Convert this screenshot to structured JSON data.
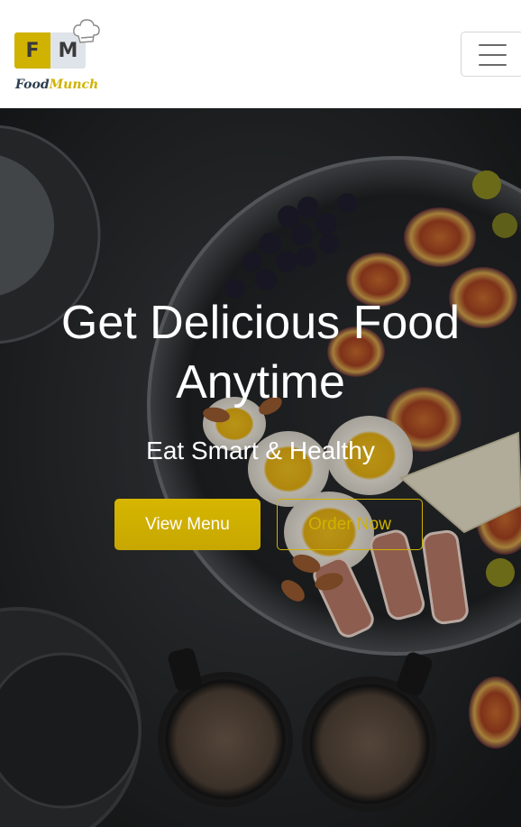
{
  "navbar": {
    "logo": {
      "letter_f": "F",
      "letter_m": "M",
      "brand_part1": "Food",
      "brand_part2": "Munch"
    },
    "menu_toggle_icon": "hamburger-icon"
  },
  "hero": {
    "title": "Get Delicious Food Anytime",
    "subtitle": "Eat Smart & Healthy",
    "view_menu_label": "View Menu",
    "order_now_label": "Order Now",
    "background_image": "dark table with plate of figs, grapes, eggs, cheese, prosciutto and coffee cups"
  },
  "colors": {
    "accent": "#d0b200",
    "logo_grey": "#dfe4ea",
    "brand_dark": "#2c3e50",
    "hero_text": "#ffffff"
  }
}
